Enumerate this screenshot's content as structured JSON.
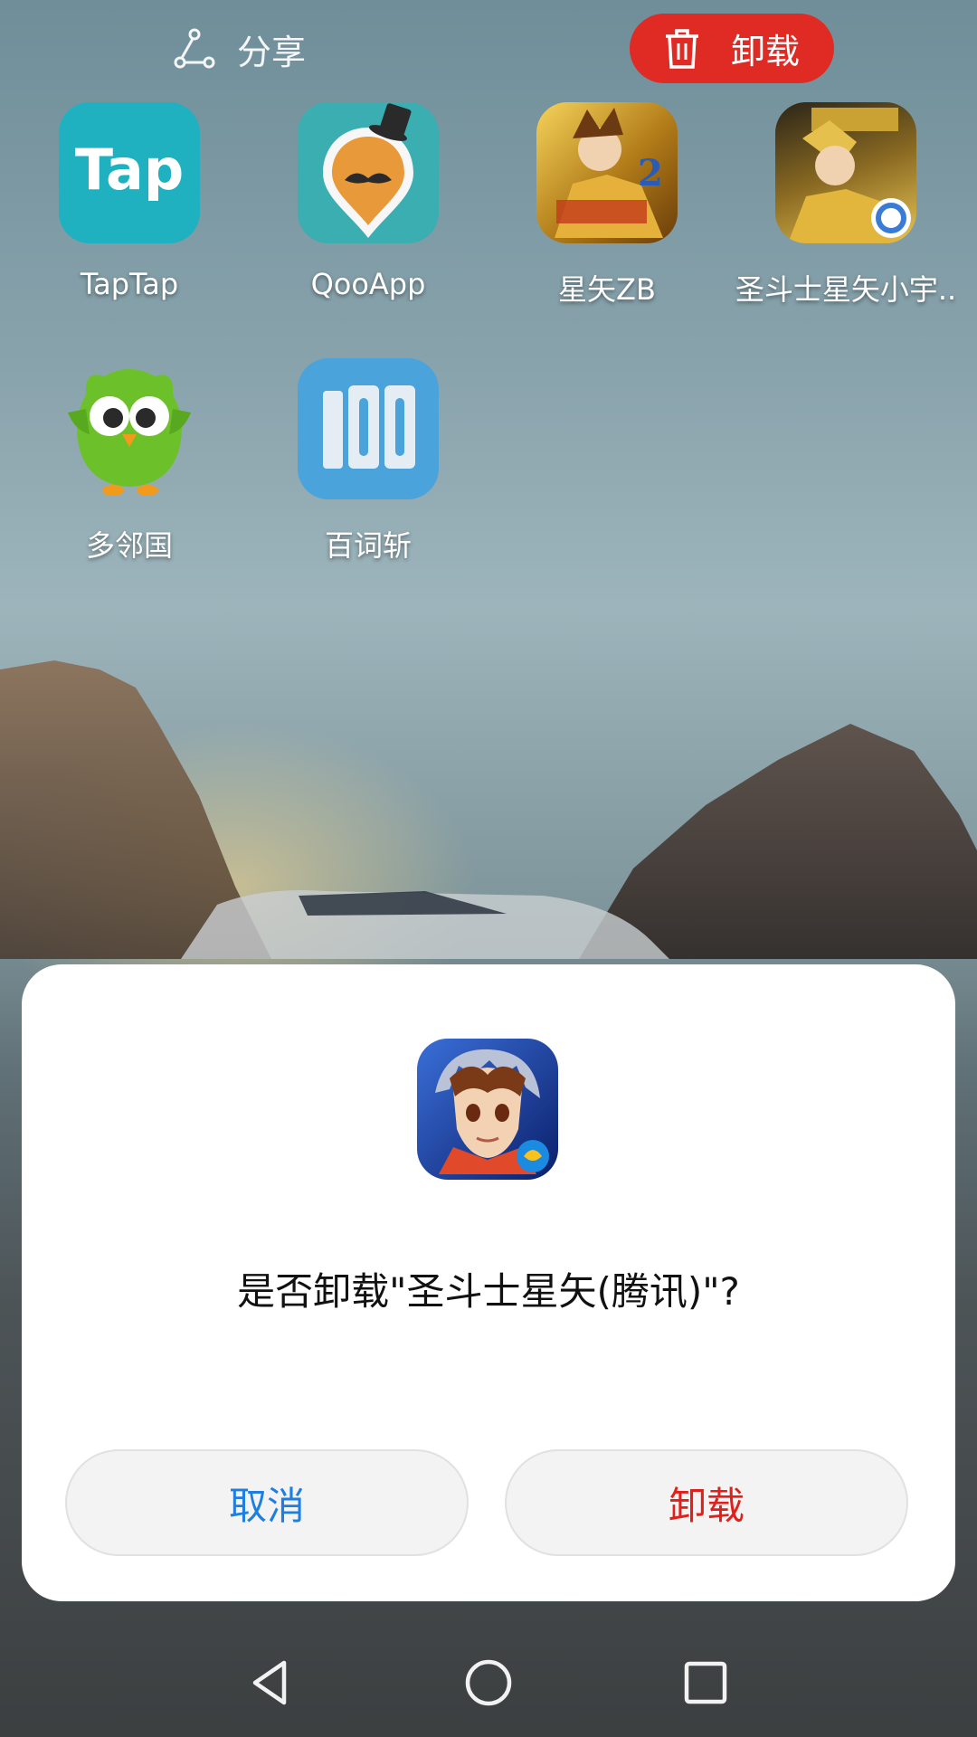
{
  "topbar": {
    "share_label": "分享",
    "uninstall_label": "卸载",
    "share_icon": "share-icon",
    "uninstall_icon": "trash-icon",
    "uninstall_color": "#e02a24"
  },
  "apps": [
    {
      "label": "TapTap",
      "icon": "taptap-icon",
      "icon_text": "Tap"
    },
    {
      "label": "QooApp",
      "icon": "qooapp-icon"
    },
    {
      "label": "星矢ZB",
      "icon": "saint-seiya-zb-icon"
    },
    {
      "label": "圣斗士星矢小宇..",
      "icon": "saint-seiya-cosmo-icon"
    },
    {
      "label": "多邻国",
      "icon": "duolingo-icon"
    },
    {
      "label": "百词斩",
      "icon": "baicizhan-icon"
    }
  ],
  "dialog": {
    "app_icon": "saint-seiya-tencent-icon",
    "message": "是否卸载\"圣斗士星矢(腾讯)\"?",
    "cancel_label": "取消",
    "confirm_label": "卸载",
    "cancel_color": "#1e7fe0",
    "confirm_color": "#e0201b"
  },
  "navbar": {
    "back_icon": "back-triangle-icon",
    "home_icon": "home-circle-icon",
    "recents_icon": "recents-square-icon"
  }
}
